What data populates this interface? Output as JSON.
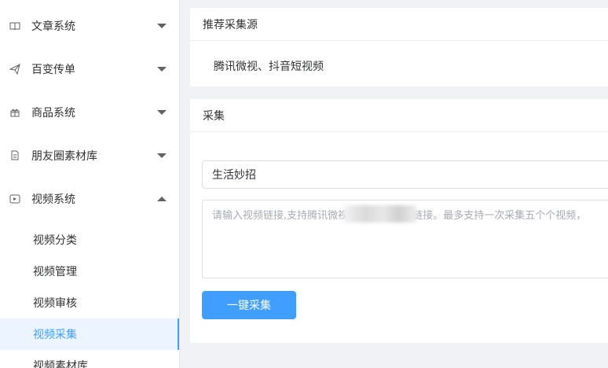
{
  "sidebar": {
    "menus": [
      {
        "label": "文章系统",
        "icon": "book-icon"
      },
      {
        "label": "百变传单",
        "icon": "paper-plane-icon"
      },
      {
        "label": "商品系统",
        "icon": "gift-icon"
      },
      {
        "label": "朋友圈素材库",
        "icon": "document-icon"
      },
      {
        "label": "视频系统",
        "icon": "video-icon"
      }
    ],
    "video_sub": [
      "视频分类",
      "视频管理",
      "视频审核",
      "视频采集",
      "视频素材库"
    ]
  },
  "recommend": {
    "title": "推荐采集源",
    "sources": "腾讯微视、抖音短视频"
  },
  "collect": {
    "title": "采集",
    "category_value": "生活妙招",
    "textarea_placeholder": "请输入视频链接,支持腾讯微视、抖音短视频 链接。最多支持一次采集五个个视频，",
    "button_label": "一键采集"
  },
  "colors": {
    "accent": "#409eff",
    "active_bg": "#ecf5ff"
  }
}
